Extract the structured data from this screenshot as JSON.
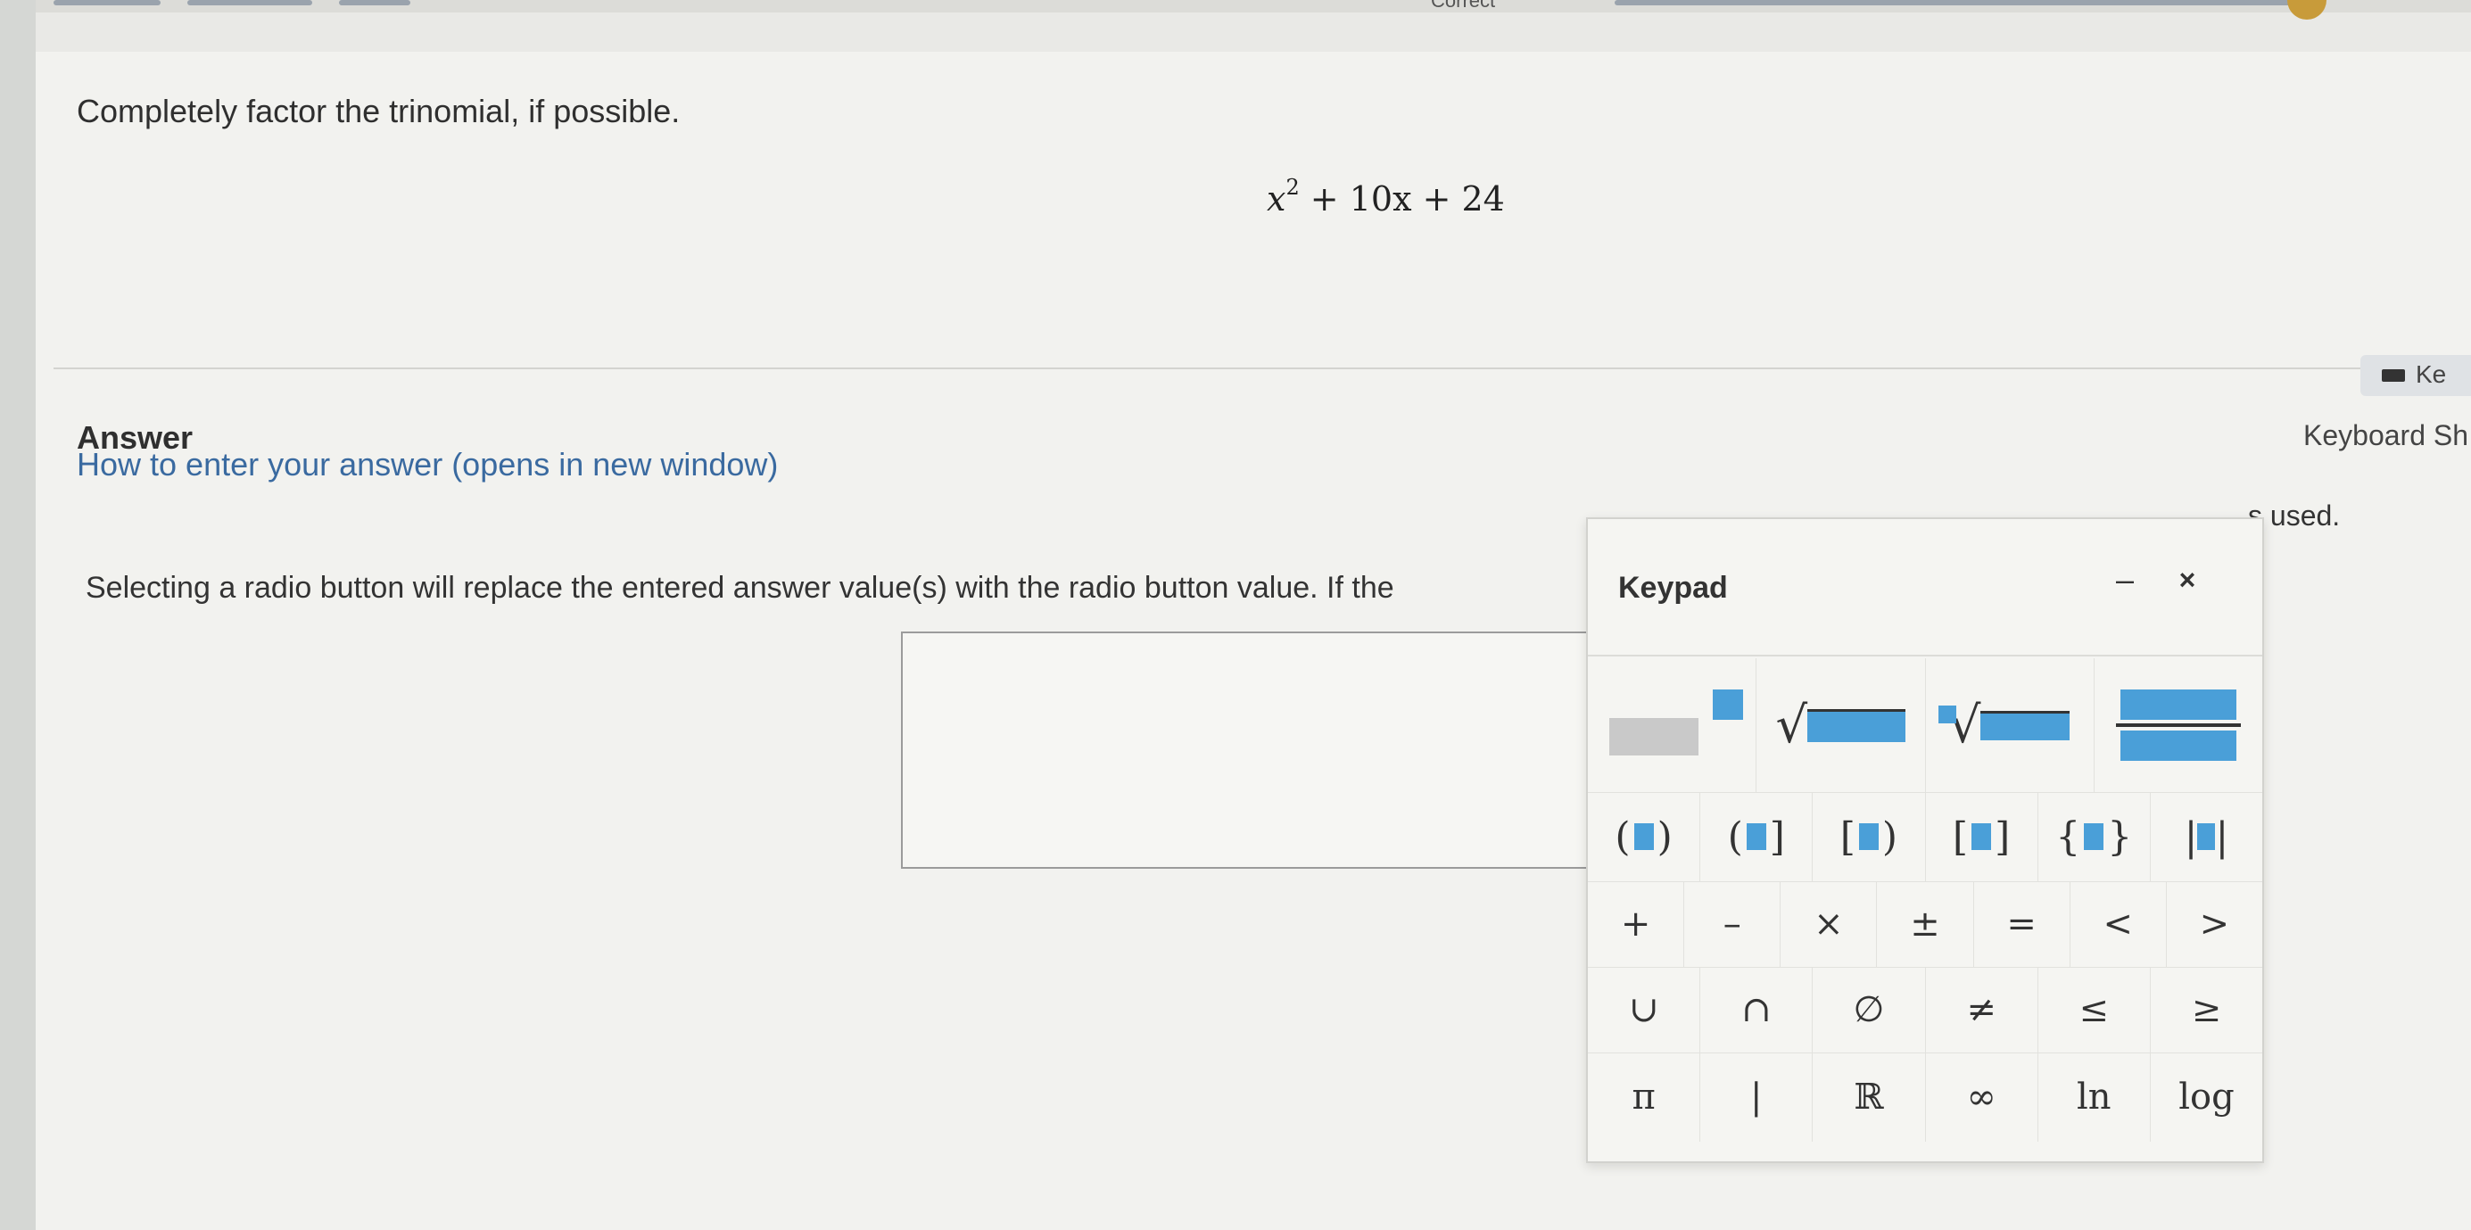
{
  "header": {
    "status": "Correct"
  },
  "question": {
    "prompt": "Completely factor the trinomial, if possible.",
    "expression_parts": [
      "x",
      "2",
      " + 10x + 24"
    ]
  },
  "answer": {
    "heading": "Answer",
    "help_link": "How to enter your answer (opens in new window)",
    "radio_note": "Selecting a radio button will replace the entered answer value(s) with the radio button value. If the",
    "radio_note_end": "s used."
  },
  "keyboard_toggle": {
    "label": "Ke",
    "shortcuts_label": "Keyboard Sh"
  },
  "keypad": {
    "title": "Keypad",
    "minimize": "–",
    "close": "×",
    "templates": [
      "power",
      "square-root",
      "nth-root",
      "fraction"
    ],
    "brackets_row": [
      "(",
      ")",
      "(",
      "]",
      "[",
      ")",
      "[",
      "]",
      "{",
      "}"
    ],
    "operators_row": [
      "+",
      "–",
      "×",
      "±",
      "=",
      "<",
      ">"
    ],
    "sets_row": [
      "∪",
      "∩",
      "∅",
      "≠",
      "≤",
      "≥"
    ],
    "misc_row": [
      "π",
      "|",
      "ℝ",
      "∞",
      "ln",
      "log"
    ]
  }
}
